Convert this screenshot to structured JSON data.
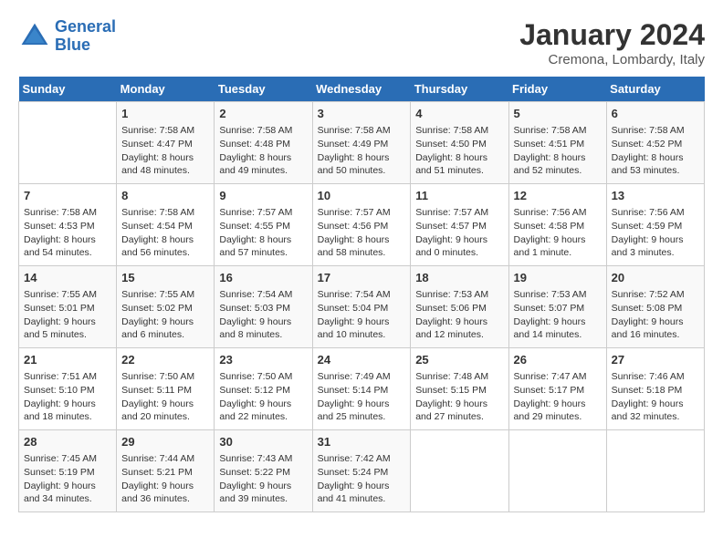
{
  "header": {
    "logo_line1": "General",
    "logo_line2": "Blue",
    "month": "January 2024",
    "location": "Cremona, Lombardy, Italy"
  },
  "days_of_week": [
    "Sunday",
    "Monday",
    "Tuesday",
    "Wednesday",
    "Thursday",
    "Friday",
    "Saturday"
  ],
  "weeks": [
    [
      {
        "day": "",
        "content": ""
      },
      {
        "day": "1",
        "content": "Sunrise: 7:58 AM\nSunset: 4:47 PM\nDaylight: 8 hours\nand 48 minutes."
      },
      {
        "day": "2",
        "content": "Sunrise: 7:58 AM\nSunset: 4:48 PM\nDaylight: 8 hours\nand 49 minutes."
      },
      {
        "day": "3",
        "content": "Sunrise: 7:58 AM\nSunset: 4:49 PM\nDaylight: 8 hours\nand 50 minutes."
      },
      {
        "day": "4",
        "content": "Sunrise: 7:58 AM\nSunset: 4:50 PM\nDaylight: 8 hours\nand 51 minutes."
      },
      {
        "day": "5",
        "content": "Sunrise: 7:58 AM\nSunset: 4:51 PM\nDaylight: 8 hours\nand 52 minutes."
      },
      {
        "day": "6",
        "content": "Sunrise: 7:58 AM\nSunset: 4:52 PM\nDaylight: 8 hours\nand 53 minutes."
      }
    ],
    [
      {
        "day": "7",
        "content": "Sunrise: 7:58 AM\nSunset: 4:53 PM\nDaylight: 8 hours\nand 54 minutes."
      },
      {
        "day": "8",
        "content": "Sunrise: 7:58 AM\nSunset: 4:54 PM\nDaylight: 8 hours\nand 56 minutes."
      },
      {
        "day": "9",
        "content": "Sunrise: 7:57 AM\nSunset: 4:55 PM\nDaylight: 8 hours\nand 57 minutes."
      },
      {
        "day": "10",
        "content": "Sunrise: 7:57 AM\nSunset: 4:56 PM\nDaylight: 8 hours\nand 58 minutes."
      },
      {
        "day": "11",
        "content": "Sunrise: 7:57 AM\nSunset: 4:57 PM\nDaylight: 9 hours\nand 0 minutes."
      },
      {
        "day": "12",
        "content": "Sunrise: 7:56 AM\nSunset: 4:58 PM\nDaylight: 9 hours\nand 1 minute."
      },
      {
        "day": "13",
        "content": "Sunrise: 7:56 AM\nSunset: 4:59 PM\nDaylight: 9 hours\nand 3 minutes."
      }
    ],
    [
      {
        "day": "14",
        "content": "Sunrise: 7:55 AM\nSunset: 5:01 PM\nDaylight: 9 hours\nand 5 minutes."
      },
      {
        "day": "15",
        "content": "Sunrise: 7:55 AM\nSunset: 5:02 PM\nDaylight: 9 hours\nand 6 minutes."
      },
      {
        "day": "16",
        "content": "Sunrise: 7:54 AM\nSunset: 5:03 PM\nDaylight: 9 hours\nand 8 minutes."
      },
      {
        "day": "17",
        "content": "Sunrise: 7:54 AM\nSunset: 5:04 PM\nDaylight: 9 hours\nand 10 minutes."
      },
      {
        "day": "18",
        "content": "Sunrise: 7:53 AM\nSunset: 5:06 PM\nDaylight: 9 hours\nand 12 minutes."
      },
      {
        "day": "19",
        "content": "Sunrise: 7:53 AM\nSunset: 5:07 PM\nDaylight: 9 hours\nand 14 minutes."
      },
      {
        "day": "20",
        "content": "Sunrise: 7:52 AM\nSunset: 5:08 PM\nDaylight: 9 hours\nand 16 minutes."
      }
    ],
    [
      {
        "day": "21",
        "content": "Sunrise: 7:51 AM\nSunset: 5:10 PM\nDaylight: 9 hours\nand 18 minutes."
      },
      {
        "day": "22",
        "content": "Sunrise: 7:50 AM\nSunset: 5:11 PM\nDaylight: 9 hours\nand 20 minutes."
      },
      {
        "day": "23",
        "content": "Sunrise: 7:50 AM\nSunset: 5:12 PM\nDaylight: 9 hours\nand 22 minutes."
      },
      {
        "day": "24",
        "content": "Sunrise: 7:49 AM\nSunset: 5:14 PM\nDaylight: 9 hours\nand 25 minutes."
      },
      {
        "day": "25",
        "content": "Sunrise: 7:48 AM\nSunset: 5:15 PM\nDaylight: 9 hours\nand 27 minutes."
      },
      {
        "day": "26",
        "content": "Sunrise: 7:47 AM\nSunset: 5:17 PM\nDaylight: 9 hours\nand 29 minutes."
      },
      {
        "day": "27",
        "content": "Sunrise: 7:46 AM\nSunset: 5:18 PM\nDaylight: 9 hours\nand 32 minutes."
      }
    ],
    [
      {
        "day": "28",
        "content": "Sunrise: 7:45 AM\nSunset: 5:19 PM\nDaylight: 9 hours\nand 34 minutes."
      },
      {
        "day": "29",
        "content": "Sunrise: 7:44 AM\nSunset: 5:21 PM\nDaylight: 9 hours\nand 36 minutes."
      },
      {
        "day": "30",
        "content": "Sunrise: 7:43 AM\nSunset: 5:22 PM\nDaylight: 9 hours\nand 39 minutes."
      },
      {
        "day": "31",
        "content": "Sunrise: 7:42 AM\nSunset: 5:24 PM\nDaylight: 9 hours\nand 41 minutes."
      },
      {
        "day": "",
        "content": ""
      },
      {
        "day": "",
        "content": ""
      },
      {
        "day": "",
        "content": ""
      }
    ]
  ]
}
